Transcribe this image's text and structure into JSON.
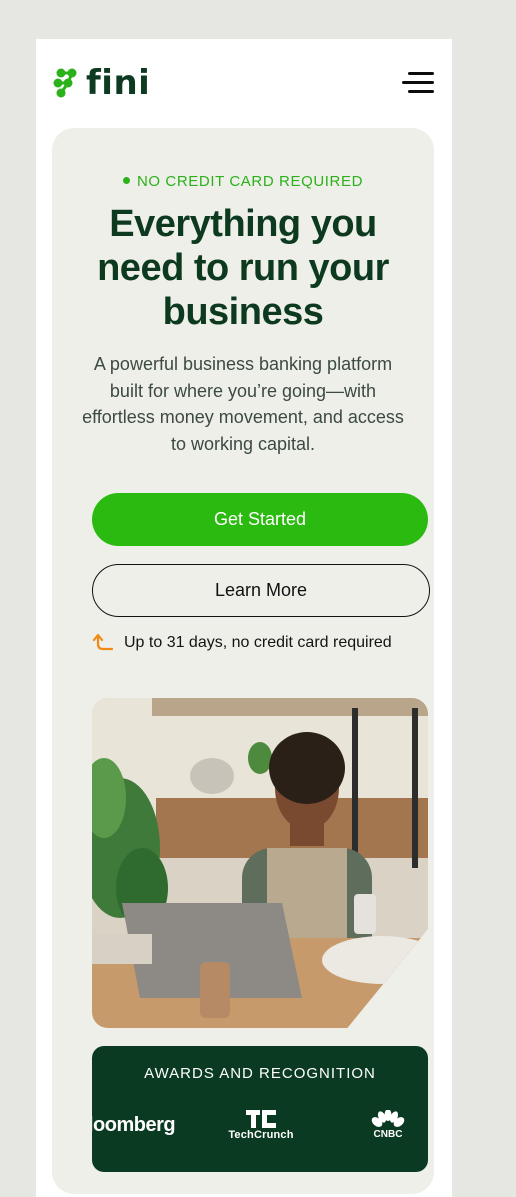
{
  "brand": {
    "name": "fini",
    "color": "#2bb11a",
    "dark": "#0f3a22"
  },
  "header": {
    "menu_icon": "hamburger-menu-icon"
  },
  "hero": {
    "eyebrow": "NO CREDIT CARD REQUIRED",
    "headline": "Everything you need to run your business",
    "subtext": "A powerful business banking platform built for where you’re going—with effortless money movement, and access to working capital.",
    "primary_cta": "Get Started",
    "secondary_cta": "Learn More",
    "trial_note": "Up to 31 days, no credit card required",
    "trial_icon": "curved-arrow-up-icon"
  },
  "photo": {
    "subject": "woman-at-laptop-with-phone"
  },
  "awards": {
    "title": "AWARDS AND RECOGNITION",
    "logos": [
      "Bloomberg",
      "TechCrunch",
      "CNBC"
    ],
    "visible_text": {
      "bloomberg": "loomberg",
      "techcrunch": "TechCrunch",
      "cnbc": "CNBC"
    }
  }
}
